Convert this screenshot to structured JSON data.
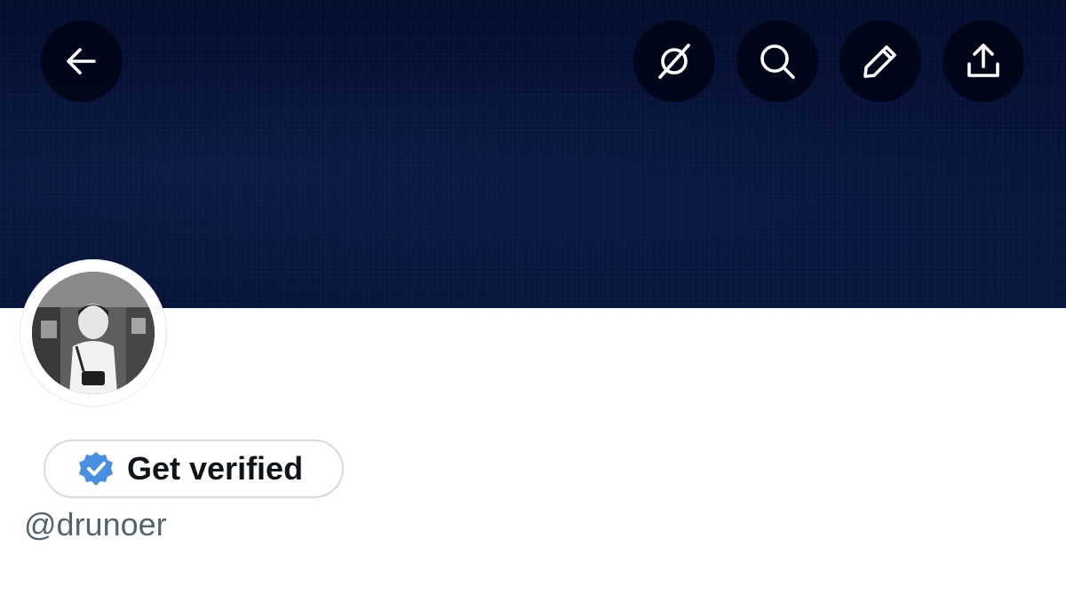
{
  "header": {
    "back_icon": "arrow-left-icon",
    "actions": [
      {
        "name": "grok",
        "icon": "grok-slash-circle-icon"
      },
      {
        "name": "search",
        "icon": "search-icon"
      },
      {
        "name": "edit",
        "icon": "pencil-icon"
      },
      {
        "name": "share",
        "icon": "share-upload-icon"
      }
    ],
    "banner_color": "#04102f"
  },
  "profile": {
    "avatar_icon": "avatar-photo",
    "verify_button": {
      "label": "Get verified",
      "badge_icon": "verified-badge-icon",
      "badge_color": "#1d9bf0"
    },
    "handle": "@drunoer"
  },
  "colors": {
    "text_primary": "#0f1419",
    "text_secondary": "#536471",
    "border": "#d3dbe0"
  }
}
